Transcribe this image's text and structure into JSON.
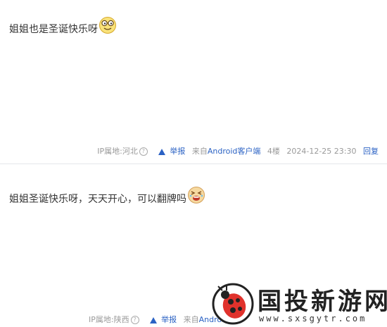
{
  "posts": [
    {
      "content": "姐姐也是圣诞快乐呀",
      "emoji": "smiley-glasses-icon",
      "ip": "IP属地:河北",
      "report": "举报",
      "source": "来自",
      "source_app": "Android客户端",
      "floor": "4楼",
      "time": "2024-12-25 23:30",
      "reply": "回复"
    },
    {
      "content": "姐姐圣诞快乐呀，天天开心，可以翻牌吗",
      "emoji": "laughing-cry-icon",
      "ip": "IP属地:陕西",
      "report": "举报",
      "source": "来自",
      "source_app": "Androi"
    }
  ],
  "watermark": {
    "title": "国投新游网",
    "url": "www.sxsgytr.com"
  },
  "colors": {
    "link": "#2b62c4",
    "meta": "#999999",
    "text": "#333333"
  }
}
